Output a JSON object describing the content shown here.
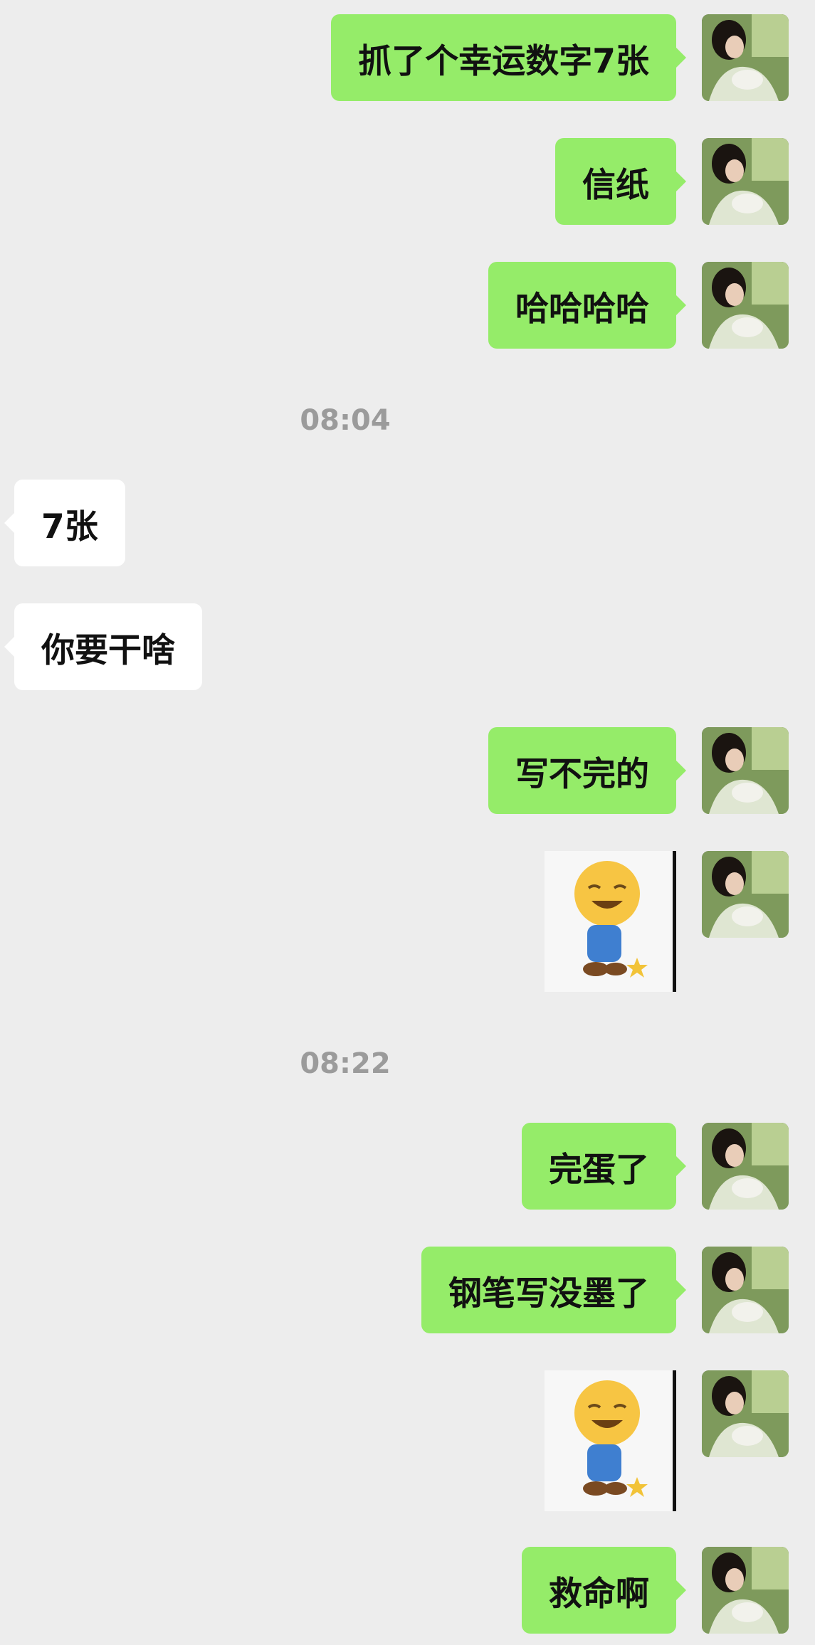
{
  "messages": [
    {
      "text": "抓了个幸运数字7张"
    },
    {
      "text": "信纸"
    },
    {
      "text": "哈哈哈哈"
    },
    {
      "text": "08:04"
    },
    {
      "text": "7张"
    },
    {
      "text": "你要干啥"
    },
    {
      "text": "写不完的"
    },
    {
      "sticker": "kneeling-smile-emoji-sticker"
    },
    {
      "text": "08:22"
    },
    {
      "text": "完蛋了"
    },
    {
      "text": "钢笔写没墨了"
    },
    {
      "sticker": "kneeling-smile-emoji-sticker"
    },
    {
      "text": "救命啊"
    }
  ],
  "colors": {
    "background": "#ededed",
    "outgoing_bubble": "#95ec69",
    "incoming_bubble": "#ffffff",
    "timestamp_text": "#9b9b9b"
  },
  "icons": {
    "avatar": "avatar-portrait-icon",
    "sticker": "kneeling-smile-emoji-sticker"
  }
}
